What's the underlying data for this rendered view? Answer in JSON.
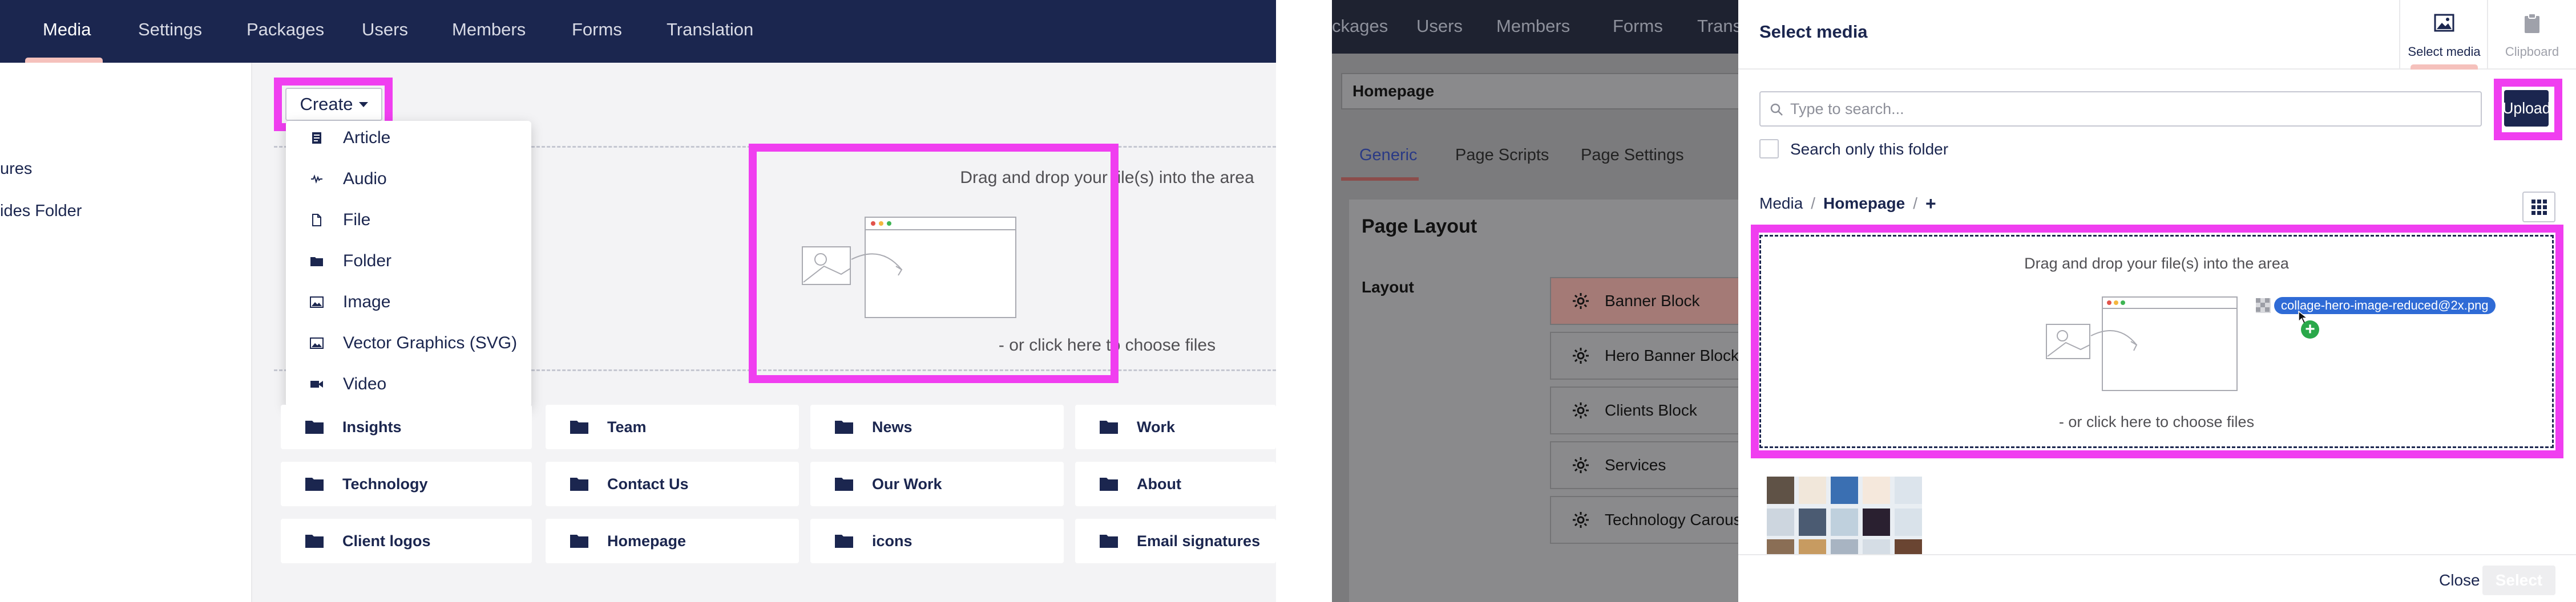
{
  "left": {
    "nav": {
      "items": [
        {
          "label": "Media",
          "active": true
        },
        {
          "label": "Settings"
        },
        {
          "label": "Packages"
        },
        {
          "label": "Users"
        },
        {
          "label": "Members"
        },
        {
          "label": "Forms"
        },
        {
          "label": "Translation"
        }
      ]
    },
    "tree": {
      "items": [
        "ures",
        "ides Folder"
      ]
    },
    "create_button": {
      "label": "Create"
    },
    "create_menu": {
      "items": [
        {
          "label": "Article",
          "icon": "article-icon"
        },
        {
          "label": "Audio",
          "icon": "audio-icon"
        },
        {
          "label": "File",
          "icon": "file-icon"
        },
        {
          "label": "Folder",
          "icon": "folder-icon"
        },
        {
          "label": "Image",
          "icon": "image-icon"
        },
        {
          "label": "Vector Graphics (SVG)",
          "icon": "vector-graphics-icon"
        },
        {
          "label": "Video",
          "icon": "video-icon"
        }
      ]
    },
    "dropzone": {
      "heading": "Drag and drop your file(s) into the area",
      "choose": "- or click here to choose files"
    },
    "folders": [
      [
        "Insights",
        "Team",
        "News",
        "Work"
      ],
      [
        "Technology",
        "Contact Us",
        "Our Work",
        "About"
      ],
      [
        "Client logos",
        "Homepage",
        "icons",
        "Email signatures"
      ]
    ]
  },
  "right": {
    "background": {
      "nav": [
        "ckages",
        "Users",
        "Members",
        "Forms",
        "Transl"
      ],
      "name_field": "Homepage",
      "tabs": [
        {
          "label": "Generic",
          "active": true
        },
        {
          "label": "Page Scripts"
        },
        {
          "label": "Page Settings"
        }
      ],
      "panel_title": "Page Layout",
      "layout_label": "Layout",
      "blocks": [
        "Banner Block",
        "Hero Banner Block",
        "Clients Block",
        "Services",
        "Technology Carousel"
      ]
    },
    "panel": {
      "title": "Select media",
      "tabs": [
        {
          "label": "Select media",
          "icon": "image-icon",
          "active": true
        },
        {
          "label": "Clipboard",
          "icon": "clipboard-icon"
        }
      ],
      "search_placeholder": "Type to search...",
      "upload_label": "Upload",
      "only_folder_label": "Search only this folder",
      "breadcrumb": {
        "root": "Media",
        "separator": "/",
        "current": "Homepage",
        "add": "+"
      },
      "dropzone": {
        "heading": "Drag and drop your file(s) into the area",
        "choose": "- or click here to choose files",
        "dragged_file": "collage-hero-image-reduced@2x.png"
      },
      "footer": {
        "close_label": "Close",
        "select_label": "Select"
      }
    },
    "colors": {
      "navy": "#1b264f",
      "highlight": "#f03ef0",
      "drag_chip": "#2f6bd6",
      "add_badge": "#2aa84a",
      "active_tab": "#f5c1bc"
    }
  }
}
